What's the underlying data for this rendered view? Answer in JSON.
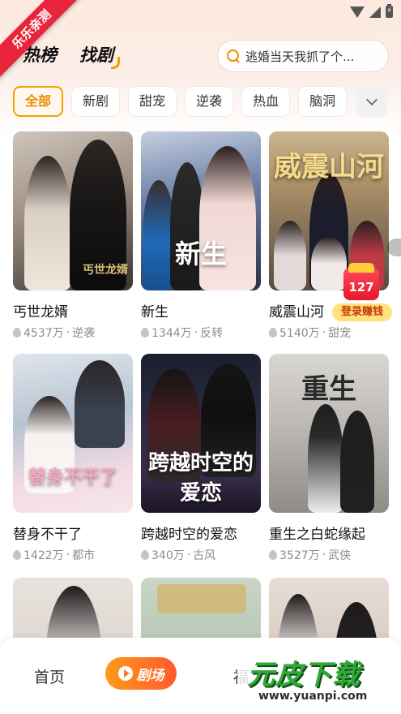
{
  "ribbon": "乐乐亲测",
  "header": {
    "tabs": [
      {
        "label": "热榜",
        "active": false
      },
      {
        "label": "找剧",
        "active": true
      }
    ]
  },
  "search": {
    "placeholder": "逃婚当天我抓了个..."
  },
  "categories": [
    "全部",
    "新剧",
    "甜宠",
    "逆袭",
    "热血",
    "脑洞"
  ],
  "active_category": "全部",
  "dramas": [
    {
      "title": "丐世龙婿",
      "views": "4537万",
      "tag": "逆袭",
      "poster_text": "丐世龙婿"
    },
    {
      "title": "新生",
      "views": "1344万",
      "tag": "反转",
      "poster_text": "新生"
    },
    {
      "title": "威震山河",
      "views": "5140万",
      "tag": "甜宠",
      "poster_text": "威震山河"
    },
    {
      "title": "替身不干了",
      "views": "1422万",
      "tag": "都市",
      "poster_text": "替身不干了"
    },
    {
      "title": "跨越时空的爱恋",
      "views": "340万",
      "tag": "古风",
      "poster_text": "跨越时空的爱恋"
    },
    {
      "title": "重生之白蛇缘起",
      "views": "3527万",
      "tag": "武侠",
      "poster_text": "重生"
    }
  ],
  "promo": {
    "number": "127",
    "label": "登录赚钱"
  },
  "bottom_nav": {
    "home": "首页",
    "theater": "剧场",
    "welfare": "福"
  },
  "watermark": {
    "logo": "元皮下载",
    "url": "www.yuanpi.com"
  },
  "colors": {
    "accent": "#f5a000",
    "ribbon": "#e8253a",
    "promo": "#e5172d"
  }
}
